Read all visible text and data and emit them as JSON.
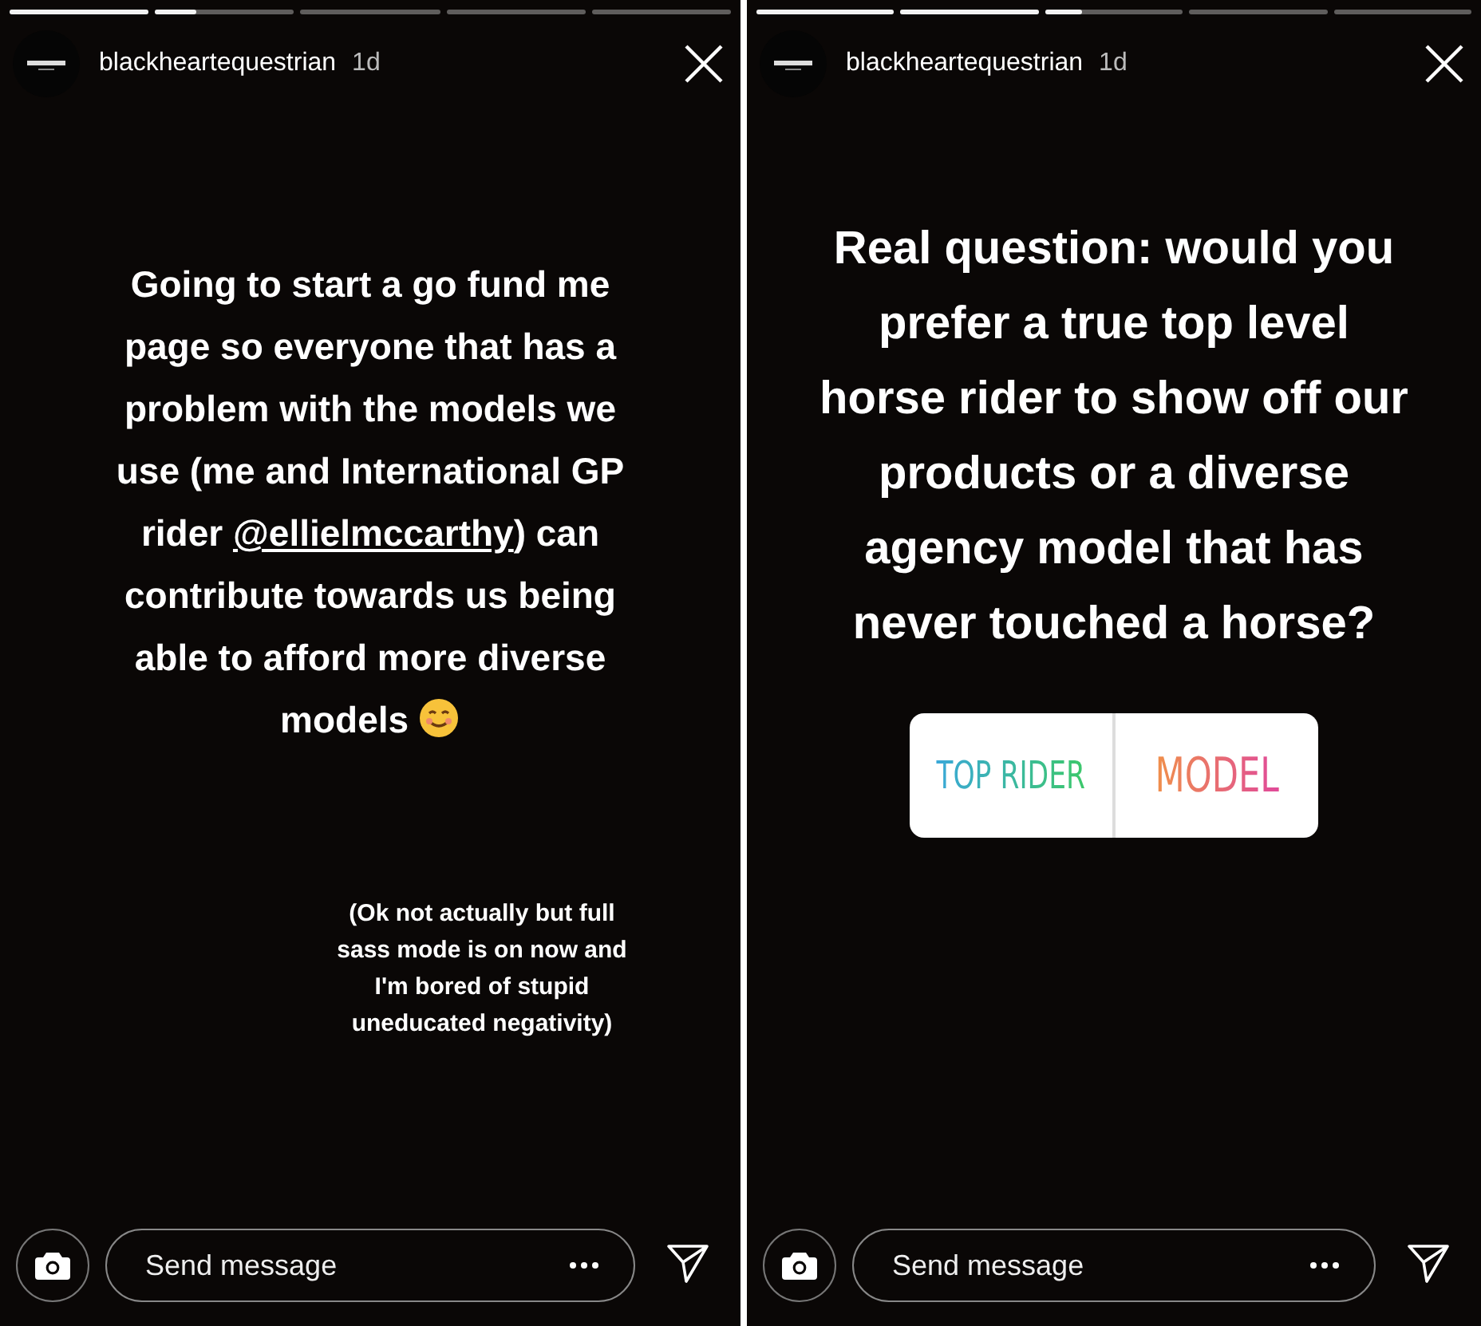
{
  "stories": [
    {
      "progress": [
        {
          "level": 1
        },
        {
          "level": 0.3
        },
        {
          "level": 0
        },
        {
          "level": 0
        },
        {
          "level": 0
        }
      ],
      "username": "blackheartequestrian",
      "age": "1d",
      "main_text": {
        "before": "Going to start a go fund me page so everyone that has a problem with the models we use (me and International GP rider ",
        "link": "@ellielmccarthy",
        "after": ") can contribute towards us being able to afford more diverse models",
        "emoji": true
      },
      "note": "(Ok not actually but full sass mode is on now and I'm bored of stupid uneducated negativity)",
      "message": {
        "placeholder": "Send message"
      }
    },
    {
      "progress": [
        {
          "level": 1
        },
        {
          "level": 1
        },
        {
          "level": 0.27
        },
        {
          "level": 0
        },
        {
          "level": 0
        }
      ],
      "username": "blackheartequestrian",
      "age": "1d",
      "question": "Real question: would you prefer a true top level horse rider to show off our products or a diverse agency model that has never touched a horse?",
      "poll": {
        "options": [
          "TOP RIDER",
          "MODEL"
        ]
      },
      "message": {
        "placeholder": "Send message"
      }
    }
  ]
}
